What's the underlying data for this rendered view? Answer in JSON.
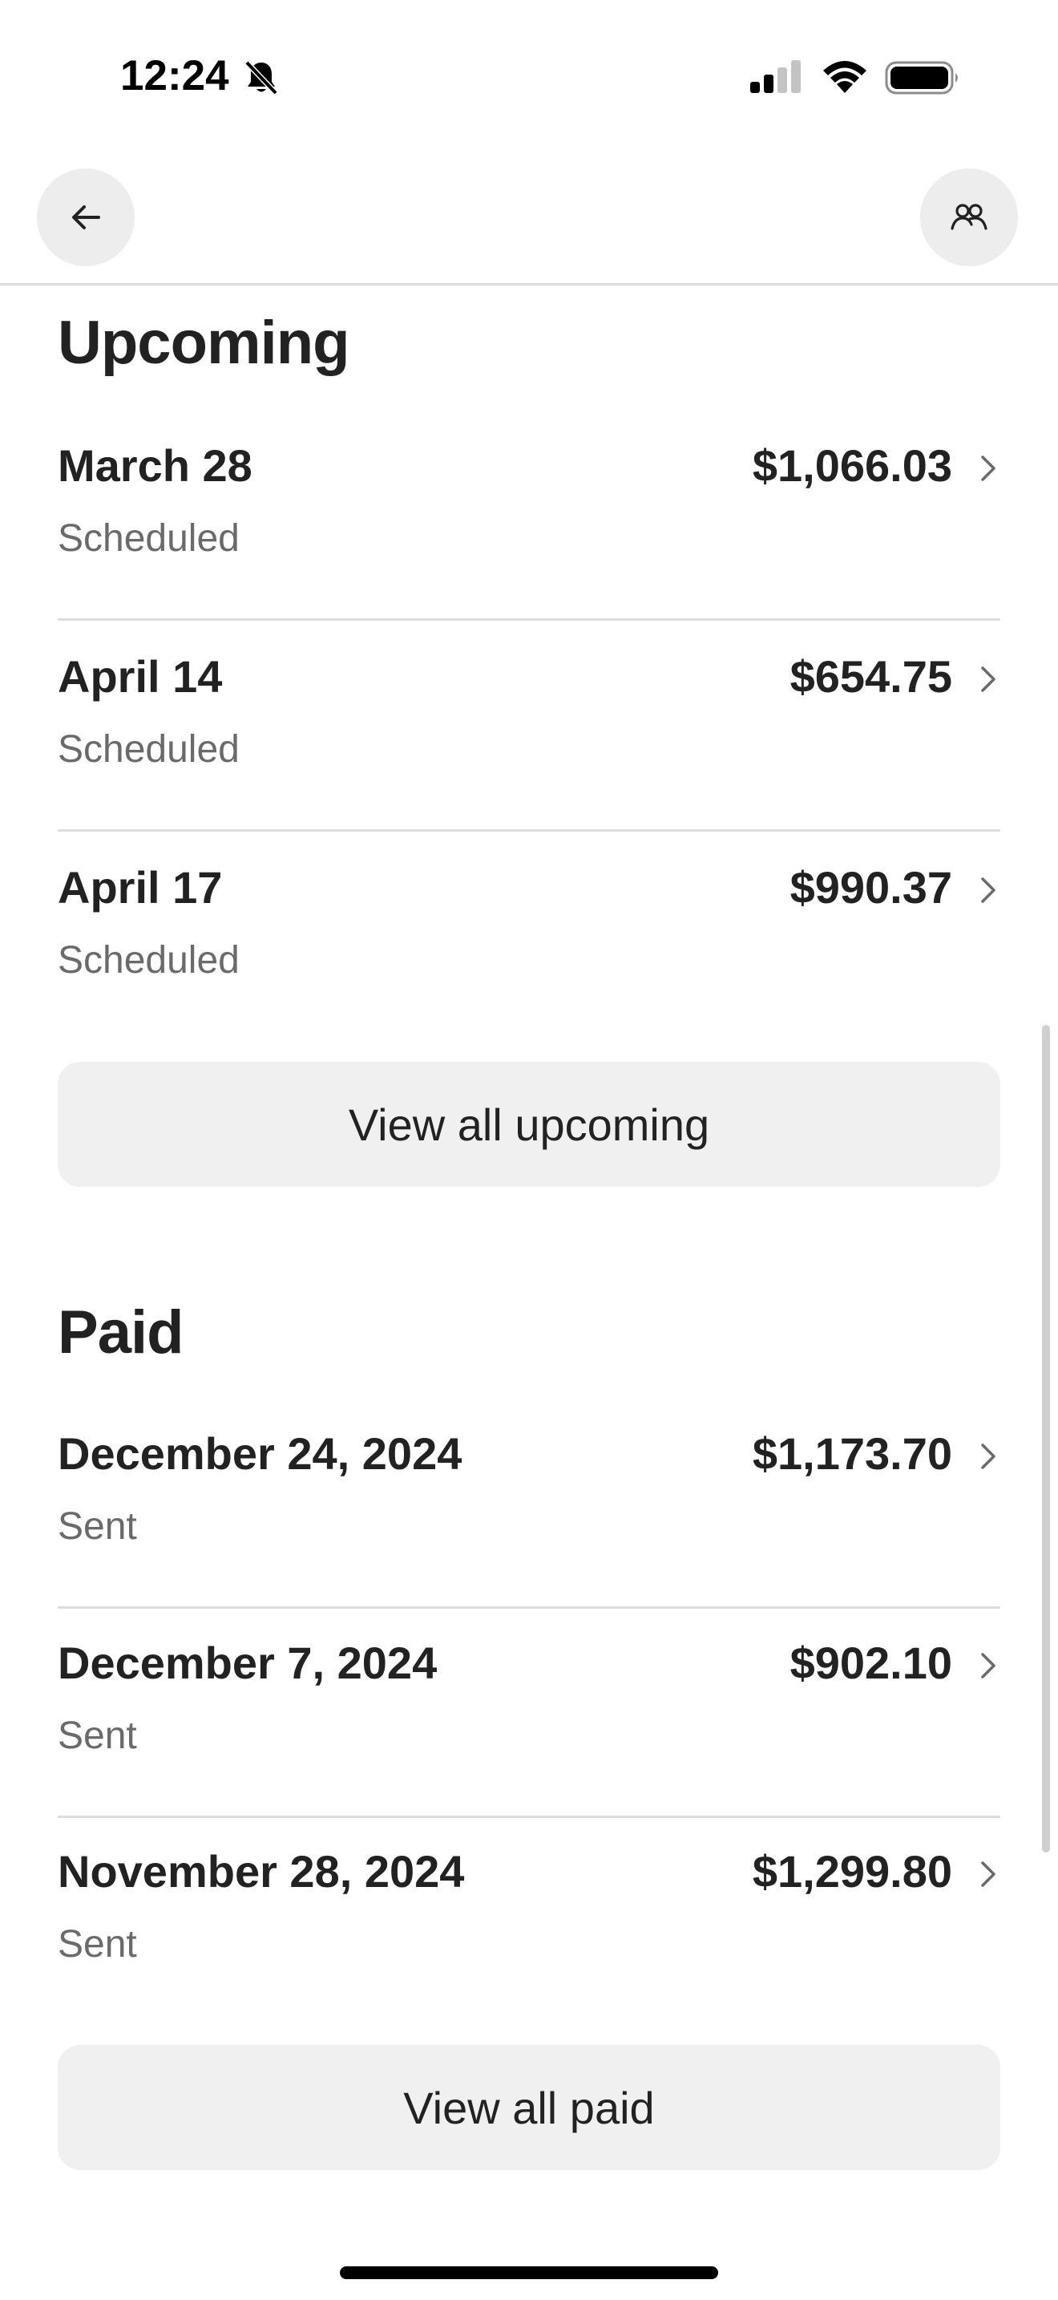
{
  "status_bar": {
    "time": "12:24",
    "icons": [
      "bell-slash-icon",
      "cellular-signal-icon",
      "wifi-icon",
      "battery-icon"
    ]
  },
  "nav": {
    "back_icon": "arrow-left-icon",
    "people_icon": "people-icon"
  },
  "upcoming": {
    "title": "Upcoming",
    "items": [
      {
        "date": "March 28",
        "status": "Scheduled",
        "amount": "$1,066.03"
      },
      {
        "date": "April 14",
        "status": "Scheduled",
        "amount": "$654.75"
      },
      {
        "date": "April 17",
        "status": "Scheduled",
        "amount": "$990.37"
      }
    ],
    "view_all_label": "View all upcoming"
  },
  "paid": {
    "title": "Paid",
    "items": [
      {
        "date": "December 24, 2024",
        "status": "Sent",
        "amount": "$1,173.70"
      },
      {
        "date": "December 7, 2024",
        "status": "Sent",
        "amount": "$902.10"
      },
      {
        "date": "November 28, 2024",
        "status": "Sent",
        "amount": "$1,299.80"
      }
    ],
    "view_all_label": "View all paid"
  },
  "colors": {
    "text_primary": "#222222",
    "text_secondary": "#6a6a6a",
    "button_bg": "#f0f0f0",
    "divider": "#dddddd"
  }
}
